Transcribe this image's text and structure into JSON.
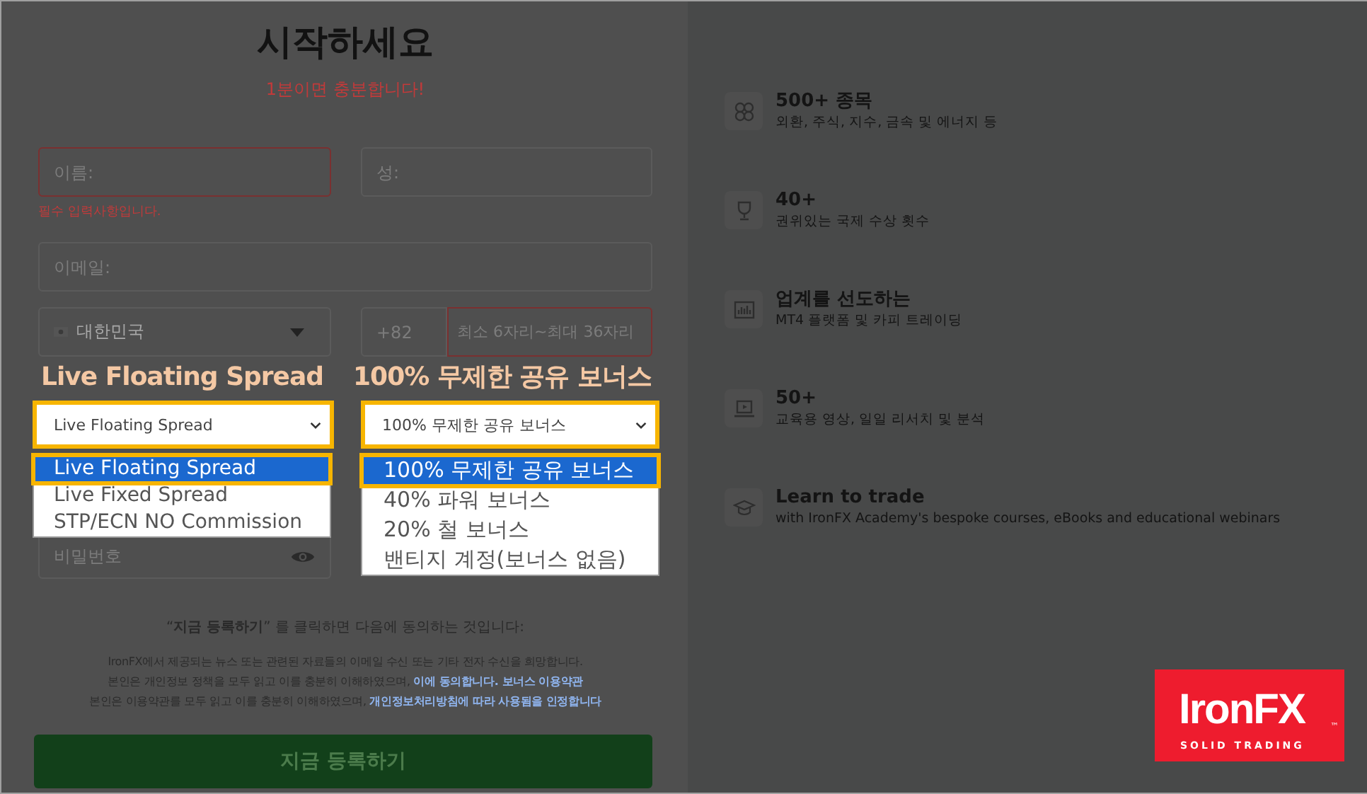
{
  "heading": {
    "title": "시작하세요",
    "subtitle": "1분이면 충분합니다!"
  },
  "name_fields": [
    {
      "placeholder": "이름:",
      "invalid": true
    },
    {
      "placeholder": "성:",
      "invalid": false
    }
  ],
  "name_error": "필수 입력사항입니다.",
  "email": {
    "placeholder": "이메일:"
  },
  "country": {
    "value": "대한민국"
  },
  "phone": {
    "code": "+82",
    "placeholder": "최소 6자리~최대 36자리",
    "invalid": true
  },
  "annotations": [
    {
      "label": "Live Floating Spread"
    },
    {
      "label": "100% 무제한 공유 보너스"
    }
  ],
  "selects": [
    {
      "value": "Live Floating Spread",
      "options": [
        {
          "label": "Live Floating Spread",
          "selected": true
        },
        {
          "label": "Live Fixed Spread",
          "selected": false
        },
        {
          "label": "STP/ECN NO Commission",
          "selected": false
        }
      ]
    },
    {
      "value": "100% 무제한 공유 보너스",
      "options": [
        {
          "label": "100% 무제한 공유 보너스",
          "selected": true
        },
        {
          "label": "40% 파워 보너스",
          "selected": false
        },
        {
          "label": "20% 철 보너스",
          "selected": false
        },
        {
          "label": "밴티지 계정(보너스 없음)",
          "selected": false
        }
      ]
    }
  ],
  "password": {
    "placeholder": "비밀번호"
  },
  "consent": {
    "intro": "“**지금 등록하기**” 를 클릭하면 다음에 동의하는 것입니다:",
    "lines": [
      {
        "text": "IronFX에서 제공되는 뉴스 또는 관련된 자료들의 이메일 수신 또는 기타 전자 수신을 희망합니다."
      },
      {
        "text": "본인은 개인정보 정책을 모두 읽고 이를 충분히 이해하였으며, ",
        "link": "이에 동의합니다. 보너스 이용약관"
      },
      {
        "text": "본인은 이용약관를 모두 읽고 이를 충분히 이해하였으며, ",
        "link": "개인정보처리방침에 따라 사용됨을 인정합니다"
      }
    ]
  },
  "submit_button": "지금 등록하기",
  "features": [
    {
      "title": "500+ 종목",
      "subtitle": "외환, 주식, 지수, 금속 및 에너지 등"
    },
    {
      "title": "40+",
      "subtitle": "권위있는 국제 수상 횟수"
    },
    {
      "title": "업계를 선도하는",
      "subtitle": "MT4 플랫폼 및 카피 트레이딩"
    },
    {
      "title": "50+",
      "subtitle": "교육용 영상, 일일 리서치 및 분석"
    },
    {
      "title": "Learn to trade",
      "subtitle": "with IronFX Academy's bespoke courses, eBooks and educational webinars"
    }
  ],
  "logo": {
    "wordmark": "IronFX",
    "tagline": "SOLID TRADING",
    "mark": "™"
  }
}
